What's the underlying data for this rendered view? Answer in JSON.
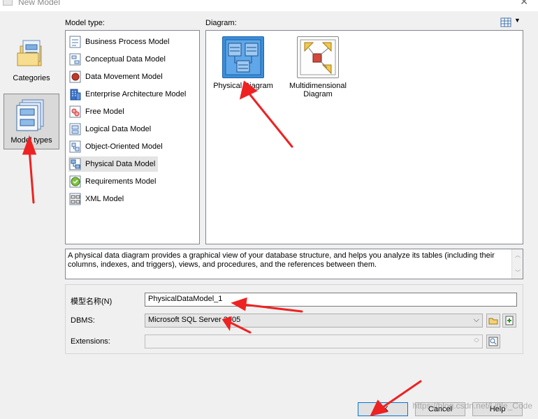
{
  "window": {
    "title": "New Model"
  },
  "left_pane": {
    "categories_label": "Categories",
    "model_types_label": "Model types"
  },
  "model_type": {
    "heading": "Model type:",
    "items": [
      {
        "label": "Business Process Model",
        "icon": "business-process-icon"
      },
      {
        "label": "Conceptual Data Model",
        "icon": "conceptual-data-icon"
      },
      {
        "label": "Data Movement Model",
        "icon": "data-movement-icon"
      },
      {
        "label": "Enterprise Architecture Model",
        "icon": "enterprise-architecture-icon"
      },
      {
        "label": "Free Model",
        "icon": "free-model-icon"
      },
      {
        "label": "Logical Data Model",
        "icon": "logical-data-icon"
      },
      {
        "label": "Object-Oriented Model",
        "icon": "object-oriented-icon"
      },
      {
        "label": "Physical Data Model",
        "icon": "physical-data-icon",
        "selected": true
      },
      {
        "label": "Requirements Model",
        "icon": "requirements-icon"
      },
      {
        "label": "XML Model",
        "icon": "xml-model-icon"
      }
    ]
  },
  "diagram": {
    "heading": "Diagram:",
    "items": [
      {
        "label_line1": "Physical Diagram",
        "label_line2": "",
        "selected": true
      },
      {
        "label_line1": "Multidimensional",
        "label_line2": "Diagram",
        "selected": false
      }
    ]
  },
  "description": "A physical data diagram provides a graphical view of your database structure, and helps you analyze its tables (including their columns, indexes, and triggers), views, and procedures, and the references between them.",
  "properties": {
    "name_label": "模型名称(N)",
    "name_value": "PhysicalDataModel_1",
    "dbms_label": "DBMS:",
    "dbms_value": "Microsoft SQL Server 2005",
    "extensions_label": "Extensions:",
    "extensions_value": ""
  },
  "buttons": {
    "ok": "OK",
    "cancel": "Cancel",
    "help": "Help"
  },
  "watermark": "https://blog.csdn.net/Little_Code",
  "colors": {
    "annotation_arrow": "#ee2222",
    "selection_blue": "#3a8fd8"
  }
}
